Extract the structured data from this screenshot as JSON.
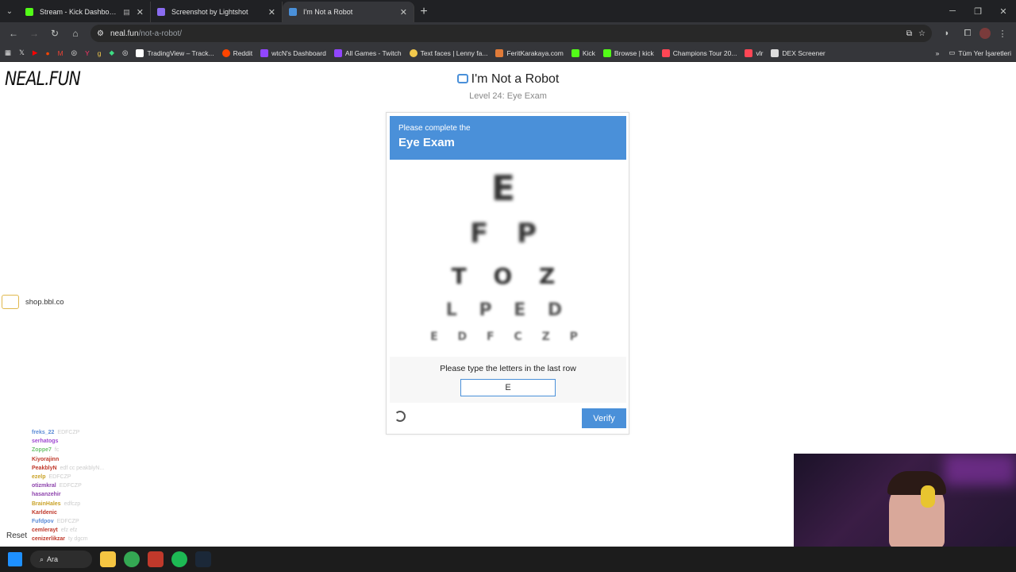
{
  "browser": {
    "tabs": [
      {
        "label": "Stream - Kick Dashboard",
        "extra": "▤",
        "color": "#53fc18"
      },
      {
        "label": "Screenshot by Lightshot",
        "color": "#8a6cf0"
      },
      {
        "label": "I'm Not a Robot",
        "color": "#4a90d9"
      }
    ],
    "url_host": "neal.fun",
    "url_path": "/not-a-robot/",
    "bookmarks": [
      {
        "label": "TradingView – Track...",
        "color": "#ffffff"
      },
      {
        "label": "Reddit",
        "color": "#ff4500"
      },
      {
        "label": "wtcN's Dashboard",
        "color": "#9146ff"
      },
      {
        "label": "All Games - Twitch",
        "color": "#9146ff"
      },
      {
        "label": "Text faces | Lenny fa...",
        "color": "#f2c94c"
      },
      {
        "label": "FeritKarakaya.com",
        "color": "#e07b39"
      },
      {
        "label": "Kick",
        "color": "#53fc18"
      },
      {
        "label": "Browse | kick",
        "color": "#53fc18"
      },
      {
        "label": "Champions Tour 20...",
        "color": "#ff4655"
      },
      {
        "label": "vlr",
        "color": "#ff4655"
      },
      {
        "label": "DEX Screener",
        "color": "#dddddd"
      }
    ],
    "all_bookmarks": "Tüm Yer İşaretleri"
  },
  "page": {
    "logo": "NEAL.FUN",
    "title": "I'm Not a Robot",
    "level": "Level 24: Eye Exam",
    "captcha": {
      "header_line1": "Please complete the",
      "header_line2": "Eye Exam",
      "rows": [
        "E",
        "F P",
        "T O Z",
        "L P E D",
        "E D F C Z P"
      ],
      "prompt": "Please type the letters in the last row",
      "answer_value": "E",
      "verify_label": "Verify"
    },
    "cart_label": "shop.bbl.co",
    "reset_label": "Reset"
  },
  "chat": [
    {
      "name": "freks_22",
      "color": "#5b8bd6",
      "text": "EDFCZP"
    },
    {
      "name": "serhatogs",
      "color": "#a04ad1",
      "text": ""
    },
    {
      "name": "Zoppe7",
      "color": "#6fc36f",
      "text": "fc"
    },
    {
      "name": "Kiyorajinn",
      "color": "#c0392b",
      "text": ""
    },
    {
      "name": "PeakblyN",
      "color": "#c0392b",
      "text": "edf cc peakblyN..."
    },
    {
      "name": "ezelp",
      "color": "#c9a227",
      "text": "EDFCZP"
    },
    {
      "name": "otizmkral",
      "color": "#8e44ad",
      "text": "EDFCZP"
    },
    {
      "name": "hasanzehir",
      "color": "#8e44ad",
      "text": ""
    },
    {
      "name": "BrainHales",
      "color": "#c9a227",
      "text": "edfczp"
    },
    {
      "name": "Karldenic",
      "color": "#c0392b",
      "text": ""
    },
    {
      "name": "Fufdpov",
      "color": "#5b8bd6",
      "text": "EDFCZP"
    },
    {
      "name": "cemlerayt",
      "color": "#c0392b",
      "text": "efz efz"
    },
    {
      "name": "cenizerlikzar",
      "color": "#c0392b",
      "text": "ty dgcm"
    }
  ],
  "taskbar": {
    "search_label": "Ara"
  }
}
